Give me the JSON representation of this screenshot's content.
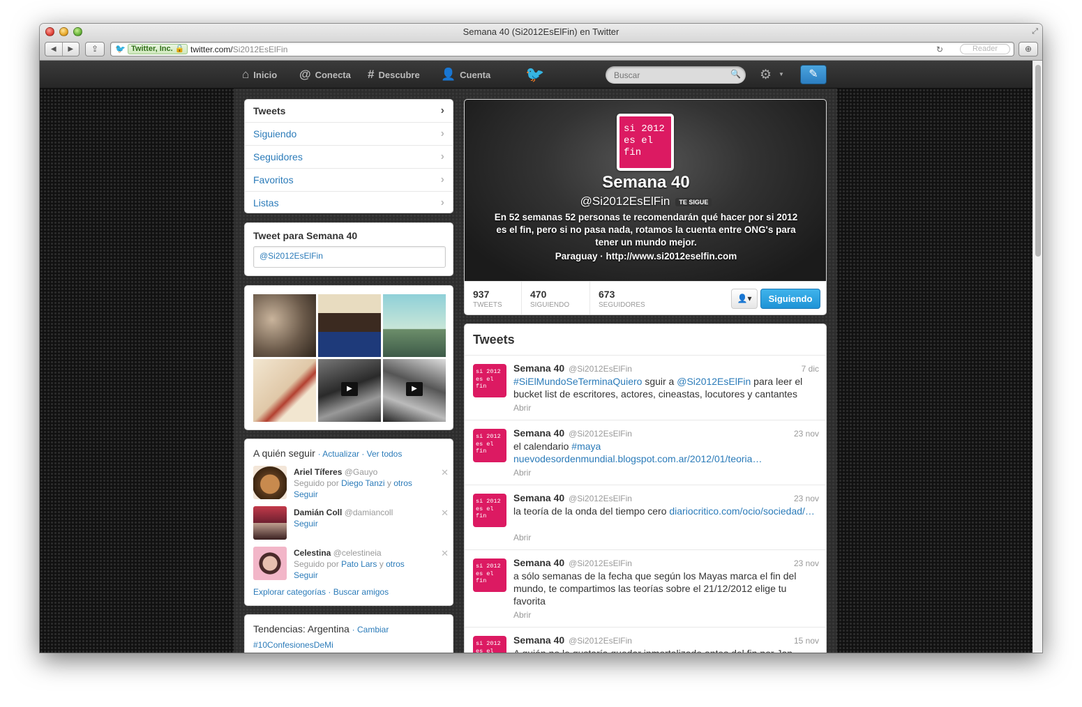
{
  "browser": {
    "window_title": "Semana 40 (Si2012EsElFin) en Twitter",
    "ev_label": "Twitter, Inc.",
    "url_host": "twitter.com/",
    "url_path": "Si2012EsElFin",
    "reader_label": "Reader"
  },
  "topbar": {
    "nav": [
      "Inicio",
      "Conecta",
      "Descubre",
      "Cuenta"
    ],
    "search_placeholder": "Buscar"
  },
  "profile_nav": {
    "items": [
      "Tweets",
      "Siguiendo",
      "Seguidores",
      "Favoritos",
      "Listas"
    ]
  },
  "tweet_box": {
    "title": "Tweet para Semana 40",
    "value": "@Si2012EsElFin"
  },
  "profile": {
    "avatar_text": "si 2012\nes el\nfin",
    "name": "Semana 40",
    "handle": "@Si2012EsElFin",
    "follows_you": "TE SIGUE",
    "bio": "En 52 semanas 52 personas te recomendarán qué hacer por si 2012 es el fin, pero si no pasa nada, rotamos la cuenta entre ONG's para tener un mundo mejor.",
    "location_line": "Paraguay · http://www.si2012eselfin.com",
    "stats": [
      {
        "value": "937",
        "label": "TWEETS"
      },
      {
        "value": "470",
        "label": "SIGUIENDO"
      },
      {
        "value": "673",
        "label": "SEGUIDORES"
      }
    ],
    "following_button": "Siguiendo"
  },
  "who_to_follow": {
    "title": "A quién seguir",
    "refresh": "Actualizar",
    "view_all": "Ver todos",
    "users": [
      {
        "name": "Ariel Tíferes",
        "handle": "@Gauyo",
        "ctx_prefix": "Seguido por",
        "ctx_user": "Diego Tanzi",
        "ctx_and": "y",
        "ctx_others": "otros",
        "follow": "Seguir"
      },
      {
        "name": "Damián Coll",
        "handle": "@damiancoll",
        "follow": "Seguir"
      },
      {
        "name": "Celestina",
        "handle": "@celestineia",
        "ctx_prefix": "Seguido por",
        "ctx_user": "Pato Lars",
        "ctx_and": "y",
        "ctx_others": "otros",
        "follow": "Seguir"
      }
    ],
    "explore": "Explorar categorías",
    "find_friends": "Buscar amigos"
  },
  "trends": {
    "title": "Tendencias: Argentina",
    "change": "Cambiar",
    "items": [
      "#10ConfesionesDeMi"
    ]
  },
  "tweets": {
    "title": "Tweets",
    "open_label": "Abrir",
    "items": [
      {
        "name": "Semana 40",
        "handle": "@Si2012EsElFin",
        "time": "7 dic",
        "parts": [
          [
            "#SiElMundoSeTerminaQuiero",
            true
          ],
          [
            " sguir a ",
            false
          ],
          [
            "@Si2012EsElFin",
            true
          ],
          [
            " para leer el bucket list de escritores, actores, cineastas, locutores y cantantes",
            false
          ]
        ]
      },
      {
        "name": "Semana 40",
        "handle": "@Si2012EsElFin",
        "time": "23 nov",
        "parts": [
          [
            "el calendario ",
            false
          ],
          [
            "#maya",
            true
          ],
          [
            " ",
            false
          ],
          [
            "nuevodesordenmundial.blogspot.com.ar/2012/01/teoria…",
            true
          ]
        ]
      },
      {
        "name": "Semana 40",
        "handle": "@Si2012EsElFin",
        "time": "23 nov",
        "parts": [
          [
            "la teoría de la onda del tiempo cero ",
            false
          ],
          [
            "diariocritico.com/ocio/sociedad/…",
            true
          ]
        ]
      },
      {
        "name": "Semana 40",
        "handle": "@Si2012EsElFin",
        "time": "23 nov",
        "parts": [
          [
            "a sólo semanas de la fecha que según los Mayas marca el fin del mundo, te compartimos las teorías sobre el 21/12/2012 elige tu favorita",
            false
          ]
        ]
      },
      {
        "name": "Semana 40",
        "handle": "@Si2012EsElFin",
        "time": "15 nov",
        "parts": [
          [
            "A quién no le gustaría quedar inmortalizado antes del fin por Jan",
            false
          ]
        ]
      }
    ]
  },
  "colors": {
    "accent": "#2b7bb9",
    "brand_pink": "#dc1a62",
    "button_blue": "#1e93d6"
  }
}
